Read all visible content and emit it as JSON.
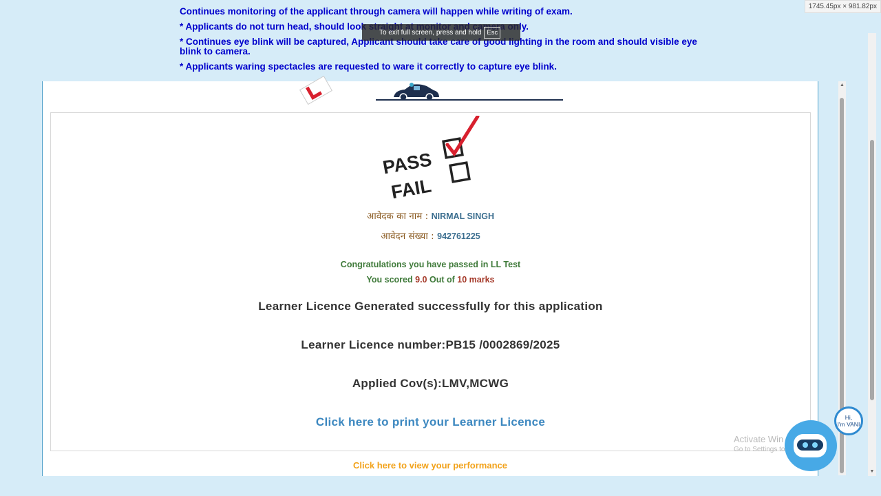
{
  "notice": {
    "line1": "Continues monitoring of the applicant through camera will happen while writing of exam.",
    "line2": "* Applicants do not turn head, should look straight at monitor and camera only.",
    "line3a": "* Continues eye blink will be captured, Applicant should take care of good lighting in the room and should visible eye",
    "line3b": "blink to camera.",
    "line4": "* Applicants waring spectacles are requested to ware it correctly to capture eye blink."
  },
  "fullscreen_toast": {
    "text": "To exit full screen, press and hold",
    "key": "Esc"
  },
  "dimension_badge": "1745.45px × 981.82px",
  "result": {
    "applicant_name_label": "आवेदक का नाम :",
    "applicant_name": "NIRMAL SINGH",
    "application_no_label": "आवेदन संख्या :",
    "application_no": "942761225",
    "congrats": "Congratulations you have passed in LL Test",
    "score_prefix": "You scored",
    "score": "9.0",
    "score_mid": "Out of",
    "max_marks": "10 marks",
    "generated": "Learner Licence Generated successfully for this application",
    "licence_number_label": "Learner Licence number:",
    "licence_number": "PB15 /0002869/2025",
    "cov_label": "Applied Cov(s):",
    "cov": "LMV,MCWG",
    "print_link": "Click here to print your Learner Licence",
    "performance_link": "Click here to view your performance"
  },
  "passfail_image": {
    "pass": "PASS",
    "fail": "FAIL"
  },
  "watermark": {
    "title": "Activate Win",
    "subtitle": "Go to Settings to"
  },
  "chatbot": {
    "greeting_line1": "Hi,",
    "greeting_line2": "I'm VANI"
  },
  "colors": {
    "notice_text": "#0000cc",
    "page_bg": "#d6ecf8",
    "link_blue": "#3d88c0",
    "performance_orange": "#f2a21a",
    "pass_red": "#d8202e"
  }
}
